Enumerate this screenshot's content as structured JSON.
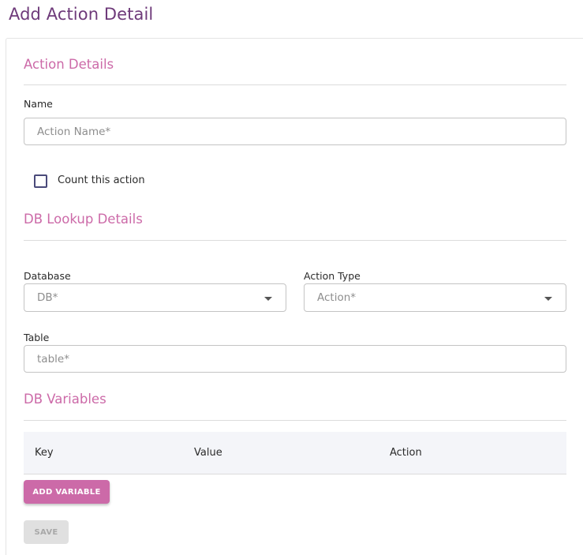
{
  "page": {
    "title": "Add Action Detail"
  },
  "action_details": {
    "heading": "Action Details",
    "name_label": "Name",
    "name_placeholder": "Action Name*",
    "name_value": "",
    "count_label": "Count this action",
    "count_checked": false
  },
  "db_lookup": {
    "heading": "DB Lookup Details",
    "database_label": "Database",
    "database_value": "DB*",
    "action_type_label": "Action Type",
    "action_type_value": "Action*",
    "table_label": "Table",
    "table_placeholder": "table*",
    "table_value": ""
  },
  "db_variables": {
    "heading": "DB Variables",
    "columns": [
      "Key",
      "Value",
      "Action"
    ],
    "rows": [],
    "add_button": "ADD VARIABLE"
  },
  "footer": {
    "save_button": "SAVE",
    "save_enabled": false
  },
  "colors": {
    "title": "#6e3a7a",
    "section_heading": "#cc6aa8",
    "primary_button": "#cc6aa8",
    "disabled_button": "#e0e0e0",
    "checkbox_border": "#4a4a7a",
    "table_header_bg": "#f4f5f9"
  }
}
